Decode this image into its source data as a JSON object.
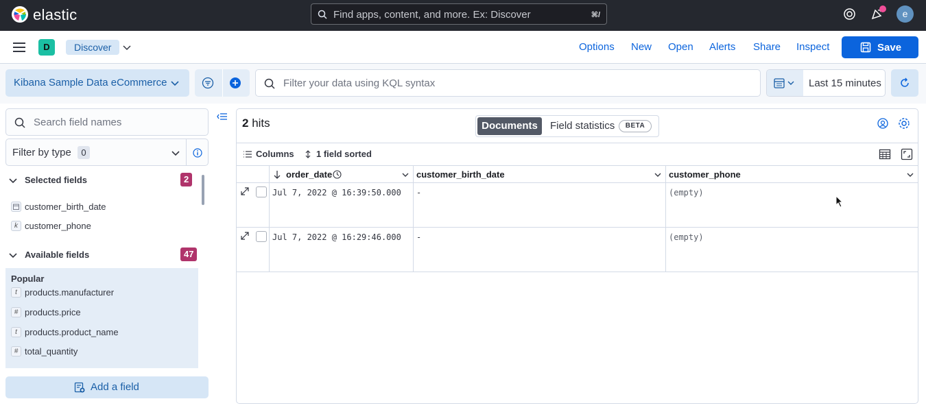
{
  "header": {
    "brand": "elastic",
    "search_placeholder": "Find apps, content, and more. Ex: Discover",
    "search_shortcut": "⌘/",
    "avatar_initial": "e"
  },
  "appbar": {
    "space_initial": "D",
    "breadcrumb": "Discover",
    "menu": [
      "Options",
      "New",
      "Open",
      "Alerts",
      "Share",
      "Inspect"
    ],
    "save_label": "Save"
  },
  "query": {
    "data_view": "Kibana Sample Data eCommerce",
    "kql_placeholder": "Filter your data using KQL syntax",
    "time_range": "Last 15 minutes"
  },
  "sidebar": {
    "search_placeholder": "Search field names",
    "filter_label": "Filter by type",
    "filter_count": "0",
    "selected_title": "Selected fields",
    "selected_count": "2",
    "selected_fields": [
      {
        "type": "date",
        "name": "customer_birth_date"
      },
      {
        "type": "k",
        "name": "customer_phone"
      }
    ],
    "available_title": "Available fields",
    "available_count": "47",
    "popular_title": "Popular",
    "popular_fields": [
      {
        "type": "t",
        "name": "products.manufacturer"
      },
      {
        "type": "#",
        "name": "products.price"
      },
      {
        "type": "t",
        "name": "products.product_name"
      },
      {
        "type": "#",
        "name": "total_quantity"
      }
    ],
    "add_field": "Add a field"
  },
  "main": {
    "hits_count": "2",
    "hits_label": "hits",
    "tab_documents": "Documents",
    "tab_stats": "Field statistics",
    "beta": "BETA",
    "columns_label": "Columns",
    "sorted_label": "1 field sorted",
    "columns": [
      "order_date",
      "customer_birth_date",
      "customer_phone"
    ],
    "rows": [
      [
        "Jul 7, 2022 @ 16:39:50.000",
        "-",
        "(empty)"
      ],
      [
        "Jul 7, 2022 @ 16:29:46.000",
        "-",
        "(empty)"
      ]
    ]
  },
  "colors": {
    "topbar": "#25282f",
    "primary": "#0b64dd",
    "count_badge": "#b0346b",
    "space_badge": "#1bbfa3"
  }
}
